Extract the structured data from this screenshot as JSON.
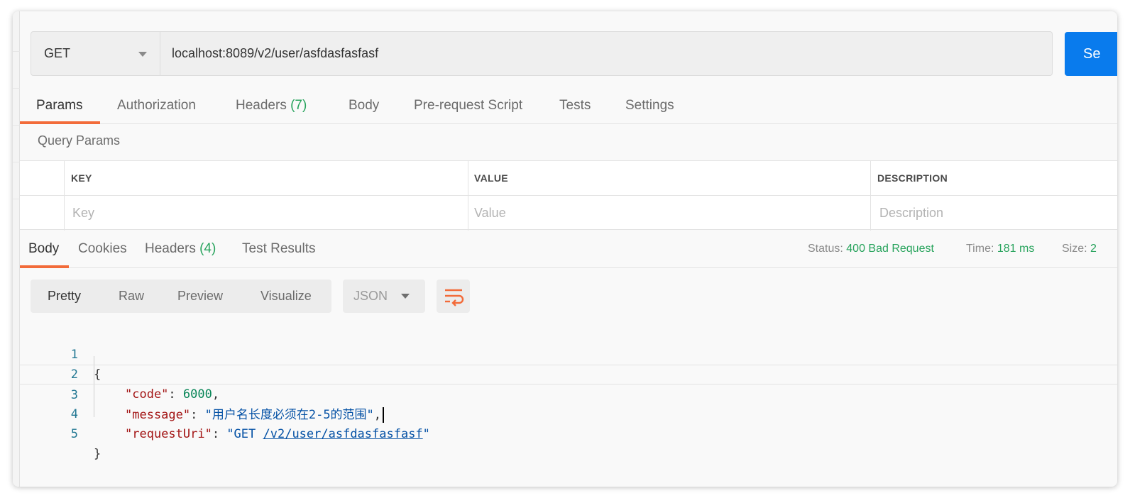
{
  "request": {
    "method": "GET",
    "url": "localhost:8089/v2/user/asfdasfasfasf",
    "send_label": "Se"
  },
  "request_tabs": [
    {
      "label": "Params",
      "count": ""
    },
    {
      "label": "Authorization",
      "count": ""
    },
    {
      "label": "Headers",
      "count": "(7)"
    },
    {
      "label": "Body",
      "count": ""
    },
    {
      "label": "Pre-request Script",
      "count": ""
    },
    {
      "label": "Tests",
      "count": ""
    },
    {
      "label": "Settings",
      "count": ""
    }
  ],
  "active_request_tab": "Params",
  "query_params": {
    "title": "Query Params",
    "columns": [
      "KEY",
      "VALUE",
      "DESCRIPTION"
    ],
    "placeholders": [
      "Key",
      "Value",
      "Description"
    ]
  },
  "response_tabs": [
    {
      "label": "Body",
      "count": ""
    },
    {
      "label": "Cookies",
      "count": ""
    },
    {
      "label": "Headers",
      "count": "(4)"
    },
    {
      "label": "Test Results",
      "count": ""
    }
  ],
  "active_response_tab": "Body",
  "response_meta": {
    "status_label": "Status:",
    "status_value": "400 Bad Request",
    "time_label": "Time:",
    "time_value": "181 ms",
    "size_label": "Size:",
    "size_value": "2"
  },
  "view_modes": [
    "Pretty",
    "Raw",
    "Preview",
    "Visualize"
  ],
  "active_view_mode": "Pretty",
  "format": "JSON",
  "code_lines": [
    {
      "n": "1",
      "open": "{"
    },
    {
      "n": "2",
      "key": "\"code\"",
      "sep": ": ",
      "value": "6000",
      "tail": ","
    },
    {
      "n": "3",
      "key": "\"message\"",
      "sep": ": ",
      "value": "\"用户名长度必须在2-5的范围\"",
      "tail": ","
    },
    {
      "n": "4",
      "key": "\"requestUri\"",
      "sep": ": ",
      "value_prefix": "\"GET ",
      "value_link": "/v2/user/asfdasfasfasf",
      "value_suffix": "\""
    },
    {
      "n": "5",
      "close": "}"
    }
  ],
  "colors": {
    "accent_tab": "#f26b3a",
    "success": "#27a35c",
    "send_button": "#097bed"
  }
}
